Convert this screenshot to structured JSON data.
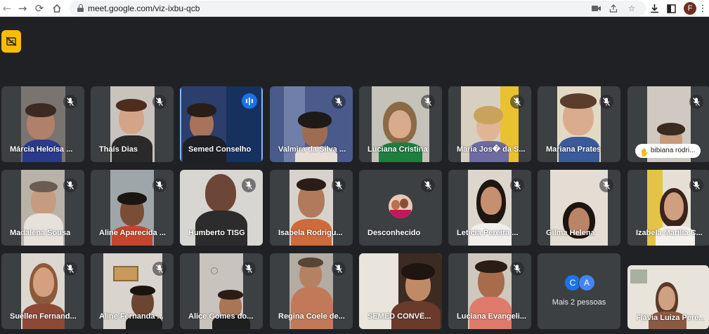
{
  "browser": {
    "url": "meet.google.com/viz-ixbu-qcb",
    "profile_initial": "F"
  },
  "participants": [
    {
      "name": "Márcia Heloísa ...",
      "muted": true
    },
    {
      "name": "Thaís Dias",
      "muted": true
    },
    {
      "name": "Semed Conselho",
      "muted": false,
      "speaking": true
    },
    {
      "name": "Valmira da Silva ...",
      "muted": true
    },
    {
      "name": "Luciana Cristina",
      "muted": true
    },
    {
      "name": "Maria Jos� da S...",
      "muted": true
    },
    {
      "name": "Mariana Prates",
      "muted": true
    },
    {
      "name": "bibiana rodri...",
      "muted": true,
      "hand_raised": true
    },
    {
      "name": "Madalena Sousa",
      "muted": true
    },
    {
      "name": "Aline Aparecida ...",
      "muted": true
    },
    {
      "name": "Humberto TISG",
      "muted": true
    },
    {
      "name": "Isabela Rodrigu...",
      "muted": true
    },
    {
      "name": "Desconhecido",
      "muted": true,
      "camera_off": true
    },
    {
      "name": "Leticia Pereira ...",
      "muted": true
    },
    {
      "name": "Gilma Helena",
      "muted": true
    },
    {
      "name": "Izabela Marília C...",
      "muted": true
    },
    {
      "name": "Suellen Fernand...",
      "muted": true
    },
    {
      "name": "Aline Fernanda ...",
      "muted": true
    },
    {
      "name": "Alice Gomes do...",
      "muted": true
    },
    {
      "name": "Regina Coele de...",
      "muted": true
    },
    {
      "name": "SEMED CONVÊ...",
      "muted": false
    },
    {
      "name": "Luciana Evangeli...",
      "muted": true
    },
    {
      "name": "Flávia Luiza Pere...",
      "muted": false
    }
  ],
  "overflow_tile": {
    "label": "Mais 2 pessoas",
    "avatars": [
      {
        "initial": "C",
        "color": "#1a73e8"
      },
      {
        "initial": "A",
        "color": "#4285f4"
      }
    ]
  },
  "colors": {
    "background": "#202124",
    "tile": "#3c4043",
    "accent": "#fbbc04",
    "speaking": "#1a73e8"
  }
}
